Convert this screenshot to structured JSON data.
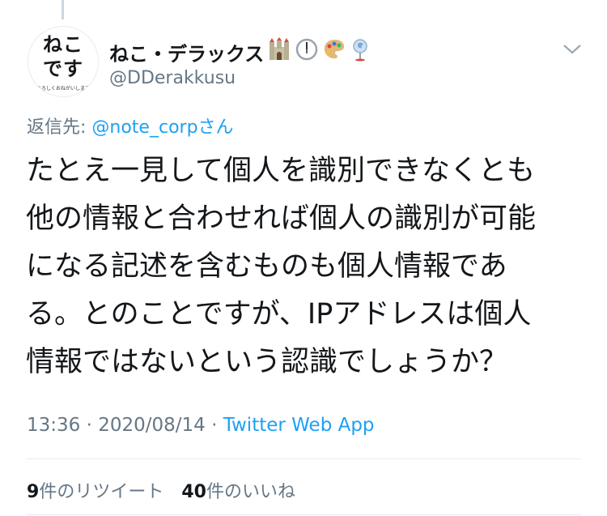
{
  "avatar": {
    "line1": "ねこ",
    "line2": "です",
    "line3": "よろしくおねがいします"
  },
  "user": {
    "display_name": "ねこ・デラックス",
    "emojis": [
      "castle-emoji",
      "clock-emoji",
      "palette-emoji",
      "map-pin-emoji"
    ],
    "handle": "@DDerakkusu"
  },
  "reply": {
    "prefix": "返信先: ",
    "mention": "@note_corp",
    "suffix": "さん"
  },
  "tweet": {
    "lines": [
      "たとえ一見して個人を識別できなくとも",
      "他の情報と合わせれば個人の識別が可能",
      "になる記述を含むものも個人情報であ",
      "る。とのことですが、IPアドレスは個人",
      "情報ではないという認識でしょうか？"
    ]
  },
  "meta": {
    "time": "13:36",
    "sep1": " · ",
    "date": "2020/08/14",
    "sep2": " · ",
    "app": "Twitter Web App"
  },
  "stats": {
    "retweets_count": "9",
    "retweets_label": "件のリツイート",
    "likes_count": "40",
    "likes_label": "件のいいね"
  },
  "colors": {
    "link": "#1da1f2",
    "secondary": "#657786",
    "primary": "#14171a",
    "divider": "#e6ecf0"
  }
}
